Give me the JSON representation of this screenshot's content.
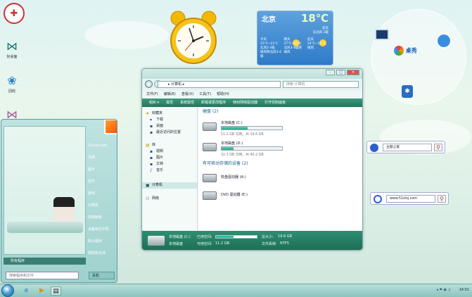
{
  "desktop_icons": [
    {
      "label": "",
      "icon": "brush-app-icon"
    },
    {
      "label": "好桌面",
      "icon": "bow-icon"
    },
    {
      "label": "回收",
      "icon": "butterfly-icon"
    },
    {
      "label": "",
      "icon": "bow-pink-icon"
    }
  ],
  "weather": {
    "city": "北京",
    "temperature": "18℃",
    "header": [
      "多云",
      "东北风 3级"
    ],
    "days": [
      {
        "lines": [
          "今天",
          "15℃~11℃",
          "北风2-3级",
          "微风转北风3-4级"
        ]
      },
      {
        "lines": [
          "明天",
          "27℃~11℃",
          "北风3-4级转",
          "微风"
        ]
      },
      {
        "lines": [
          "后天",
          "24℃~11℃",
          "微风",
          ""
        ]
      }
    ]
  },
  "circle_widget": {
    "logo_text": "桌秀",
    "logo_sub": "zhuoxiu"
  },
  "start_menu": {
    "right_items": [
      "51ztsj.com",
      "文档",
      "图片",
      "音乐",
      "游戏",
      "计算机",
      "控制面板",
      "设备和打印机",
      "默认程序",
      "帮助和支持"
    ],
    "all_programs": "所有程序",
    "search_placeholder": "搜索程序和文件",
    "shutdown": "关机"
  },
  "explorer": {
    "address": "▸ 计算机 ▸",
    "search_placeholder": "搜索 计算机",
    "menu": [
      "文件(F)",
      "编辑(E)",
      "查看(V)",
      "工具(T)",
      "帮助(H)"
    ],
    "commands": [
      "组织 ▾",
      "属性",
      "系统属性",
      "卸载或更改程序",
      "映射网络驱动器",
      "打开控制面板"
    ],
    "nav": [
      {
        "label": "收藏夹",
        "icon": "star-icon"
      },
      {
        "label": "下载",
        "icon": "download-icon"
      },
      {
        "label": "桌面",
        "icon": "desktop-icon"
      },
      {
        "label": "最近访问的位置",
        "icon": "recent-icon"
      },
      {
        "label": "库",
        "icon": "library-icon"
      },
      {
        "label": "视频",
        "icon": "video-icon"
      },
      {
        "label": "图片",
        "icon": "picture-icon"
      },
      {
        "label": "文档",
        "icon": "document-icon"
      },
      {
        "label": "音乐",
        "icon": "music-icon"
      },
      {
        "label": "计算机",
        "icon": "computer-icon"
      },
      {
        "label": "网络",
        "icon": "network-icon"
      }
    ],
    "hdd_group": "硬盘 (2)",
    "drives": [
      {
        "name": "本地磁盘 (C:)",
        "size": "11.2 GB 可用，共 19.6 GB",
        "used_fraction": 0.43
      },
      {
        "name": "本地磁盘 (D:)",
        "size": "32.3 GB 可用，共 40.2 GB",
        "used_fraction": 0.2
      }
    ],
    "removable_group": "有可移动存储的设备 (2)",
    "removable": [
      {
        "name": "软盘驱动器 (A:)",
        "icon": "floppy-icon"
      },
      {
        "name": "DVD 驱动器 (E:)",
        "icon": "dvd-icon"
      }
    ],
    "details": {
      "name": "本地磁盘 (C:)",
      "type": "本地磁盘",
      "used_label": "已用空间:",
      "free_label": "可用空间:",
      "free_value": "11.2 GB",
      "total_label": "总大小:",
      "total_value": "19.6 GB",
      "fs_label": "文件系统:",
      "fs_value": "NTFS",
      "used_fraction": 0.43
    }
  },
  "search_boxes": [
    {
      "value": "主题之家"
    },
    {
      "value": "www.51ztsj.com"
    }
  ],
  "taskbar": {
    "clock": "14:01"
  }
}
